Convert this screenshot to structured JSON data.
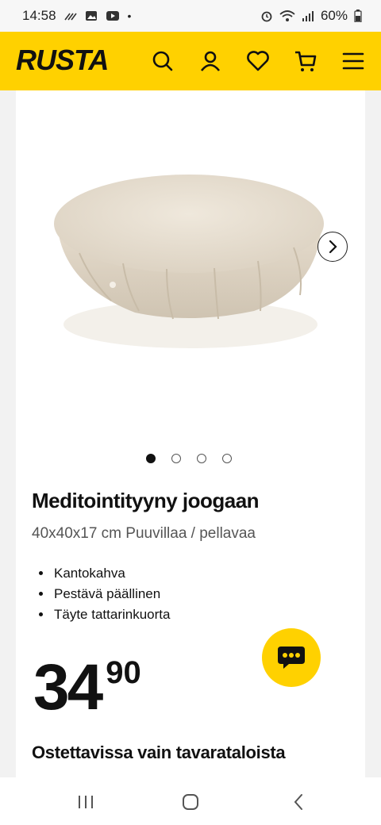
{
  "status": {
    "time": "14:58",
    "battery": "60%"
  },
  "header": {
    "logo": "RUSTA",
    "brand_color": "#ffd100"
  },
  "carousel": {
    "image_icon": "meditation-cushion-image",
    "total_slides": 4,
    "active_index": 0
  },
  "product": {
    "title": "Meditointityyny joogaan",
    "subtitle": "40x40x17 cm Puuvillaa / pellavaa",
    "features": [
      "Kantokahva",
      "Pestävä päällinen",
      "Täyte tattarinkuorta"
    ],
    "price_main": "34",
    "price_cents": "90",
    "availability": "Ostettavissa vain tavarataloista"
  }
}
